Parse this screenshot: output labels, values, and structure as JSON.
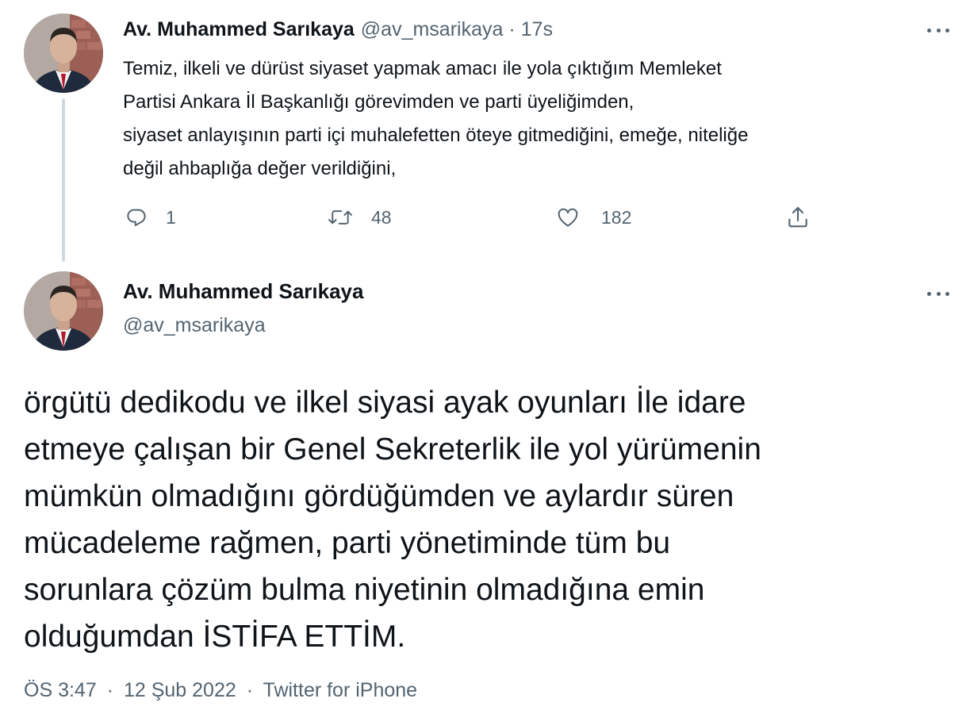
{
  "tweet1": {
    "name": "Av. Muhammed Sarıkaya",
    "handle": "@av_msarikaya",
    "dot": "·",
    "time": "17s",
    "text": "Temiz, ilkeli ve dürüst siyaset yapmak amacı ile yola çıktığım Memleket\nPartisi Ankara İl Başkanlığı görevimden ve parti üyeliğimden,\nsiyaset anlayışının parti içi muhalefetten öteye gitmediğini, emeğe, niteliğe\ndeğil ahbaplığa değer verildiğini,",
    "actions": {
      "reply": {
        "icon": "reply-icon",
        "count": "1"
      },
      "retweet": {
        "icon": "retweet-icon",
        "count": "48"
      },
      "like": {
        "icon": "heart-icon",
        "count": "182"
      },
      "share": {
        "icon": "share-icon"
      }
    }
  },
  "tweet2": {
    "name": "Av. Muhammed Sarıkaya",
    "handle": "@av_msarikaya",
    "text": "örgütü dedikodu ve ilkel siyasi ayak oyunları İle idare\netmeye çalışan bir Genel Sekreterlik ile yol yürümenin\nmümkün olmadığını gördüğümden ve aylardır süren\nmücadeleme rağmen, parti yönetiminde tüm bu\nsorunlara çözüm bulma niyetinin olmadığına emin\nolduğumdan İSTİFA ETTİM.",
    "time": "ÖS 3:47",
    "date": "12 Şub 2022",
    "dot": "·",
    "source": "Twitter for iPhone"
  },
  "colors": {
    "text": "#0f1419",
    "secondary": "#536471",
    "thread_line": "#cfd9de"
  }
}
